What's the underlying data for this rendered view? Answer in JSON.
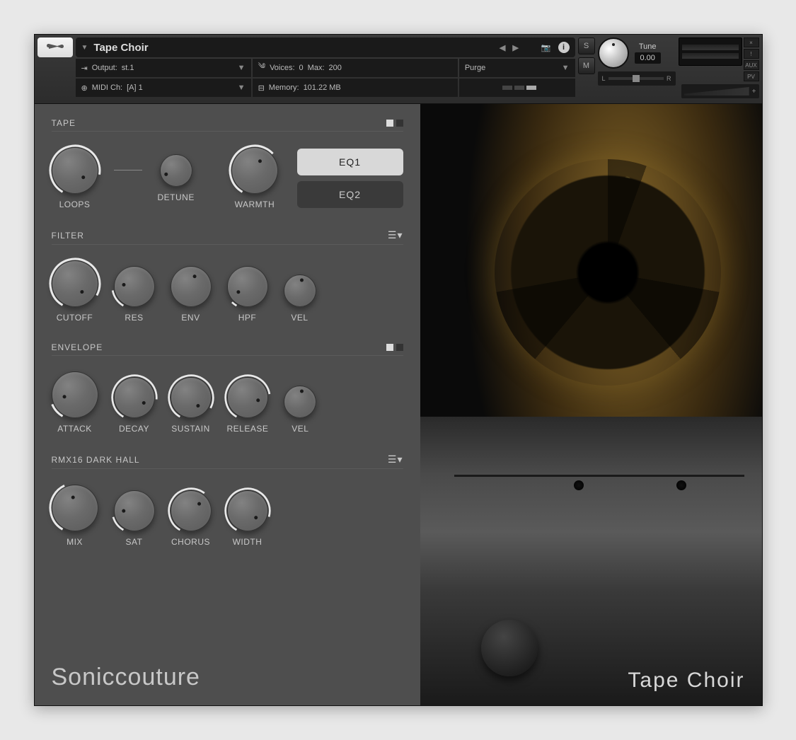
{
  "header": {
    "instrument_name": "Tape Choir",
    "output_label": "Output:",
    "output_value": "st.1",
    "voices_label": "Voices:",
    "voices_value": "0",
    "voices_max_label": "Max:",
    "voices_max_value": "200",
    "midi_label": "MIDI Ch:",
    "midi_value": "[A] 1",
    "memory_label": "Memory:",
    "memory_value": "101.22 MB",
    "purge": "Purge",
    "solo": "S",
    "mute": "M",
    "tune_label": "Tune",
    "tune_value": "0.00",
    "aux": "AUX",
    "pv": "PV",
    "close": "×",
    "minus": "!",
    "pan_l": "L",
    "pan_r": "R"
  },
  "sections": {
    "tape": {
      "title": "TAPE",
      "knobs": [
        "LOOPS",
        "DETUNE",
        "WARMTH"
      ],
      "eq": [
        "EQ1",
        "EQ2"
      ]
    },
    "filter": {
      "title": "FILTER",
      "knobs": [
        "CUTOFF",
        "RES",
        "ENV",
        "HPF",
        "VEL"
      ]
    },
    "envelope": {
      "title": "ENVELOPE",
      "knobs": [
        "ATTACK",
        "DECAY",
        "SUSTAIN",
        "RELEASE",
        "VEL"
      ]
    },
    "fx": {
      "title": "RMX16 DARK HALL",
      "knobs": [
        "MIX",
        "SAT",
        "CHORUS",
        "WIDTH"
      ]
    }
  },
  "brand": "Soniccouture",
  "product": "Tape Choir"
}
